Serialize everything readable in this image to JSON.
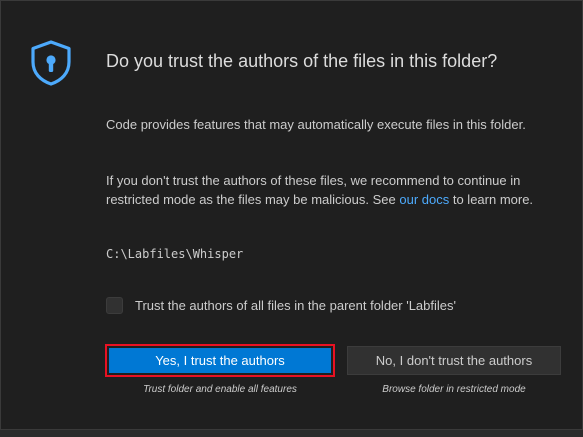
{
  "dialog": {
    "title": "Do you trust the authors of the files in this folder?",
    "paragraph1": "Code provides features that may automatically execute files in this folder.",
    "paragraph2_before_link": "If you don't trust the authors of these files, we recommend to continue in restricted mode as the files may be malicious. See ",
    "paragraph2_link": "our docs",
    "paragraph2_after_link": " to learn more.",
    "folder_path": "C:\\Labfiles\\Whisper",
    "checkbox_label": "Trust the authors of all files in the parent folder 'Labfiles'",
    "checkbox_checked": false,
    "trust_button_label": "Yes, I trust the authors",
    "trust_button_caption": "Trust folder and enable all features",
    "distrust_button_label": "No, I don't trust the authors",
    "distrust_button_caption": "Browse folder in restricted mode",
    "icon": "shield-keyhole-icon"
  },
  "colors": {
    "accent": "#0078d4",
    "link": "#4daafc",
    "highlight": "#e81123",
    "background": "#1f1f1f"
  }
}
